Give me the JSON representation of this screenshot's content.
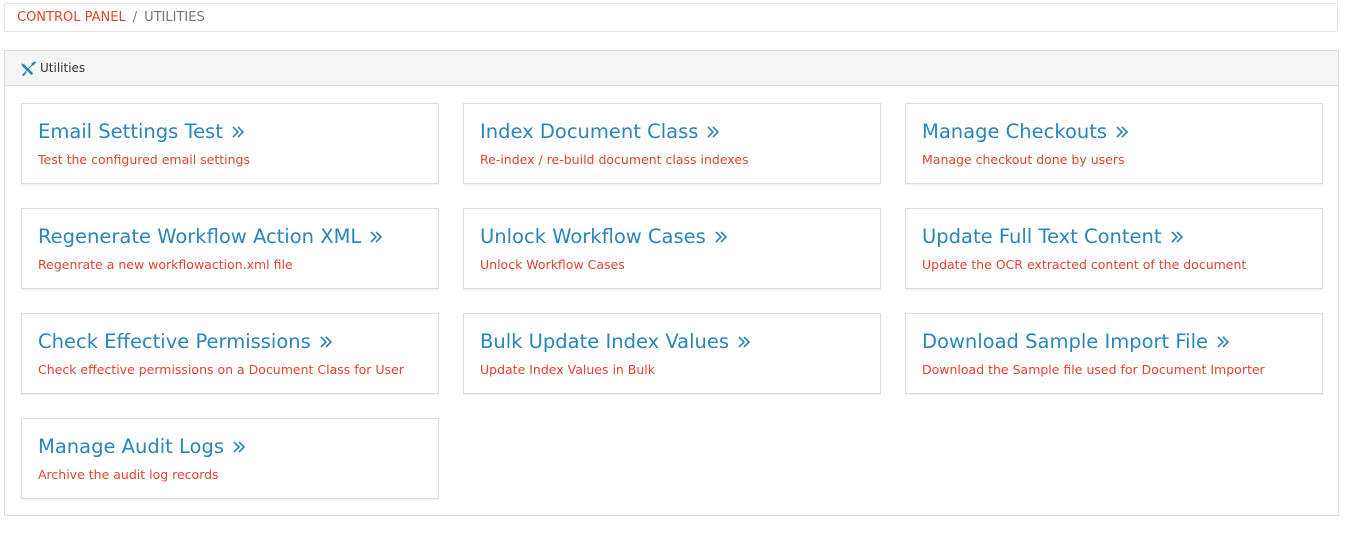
{
  "breadcrumb": {
    "root": "CONTROL PANEL",
    "separator": "/",
    "current": "UTILITIES"
  },
  "panel": {
    "title": "Utilities",
    "icon": "tools-icon"
  },
  "colors": {
    "link_blue": "#2a86b9",
    "accent_red": "#e0452f"
  },
  "cards": [
    {
      "title": "Email Settings Test",
      "desc": "Test the configured email settings"
    },
    {
      "title": "Index Document Class",
      "desc": "Re-index / re-build document class indexes"
    },
    {
      "title": "Manage Checkouts",
      "desc": "Manage checkout done by users"
    },
    {
      "title": "Regenerate Workflow Action XML",
      "desc": "Regenrate a new workflowaction.xml file"
    },
    {
      "title": "Unlock Workflow Cases",
      "desc": "Unlock Workflow Cases"
    },
    {
      "title": "Update Full Text Content",
      "desc": "Update the OCR extracted content of the document"
    },
    {
      "title": "Check Effective Permissions",
      "desc": "Check effective permissions on a Document Class for User"
    },
    {
      "title": "Bulk Update Index Values",
      "desc": "Update Index Values in Bulk"
    },
    {
      "title": "Download Sample Import File",
      "desc": "Download the Sample file used for Document Importer"
    },
    {
      "title": "Manage Audit Logs",
      "desc": "Archive the audit log records"
    }
  ]
}
